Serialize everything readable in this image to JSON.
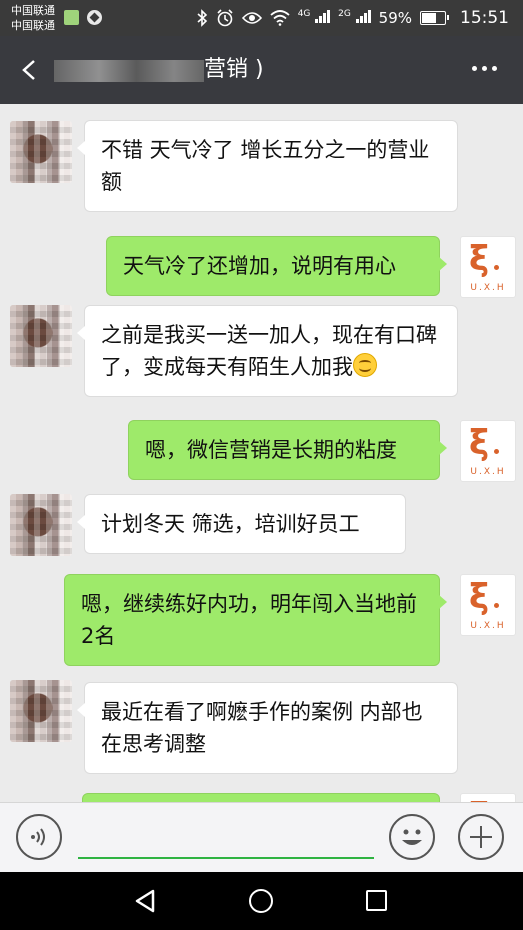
{
  "status_bar": {
    "carrier_1": "中国联通",
    "carrier_2": "中国联通",
    "network_1": "4G",
    "network_2": "2G",
    "battery": "59%",
    "battery_level": 0.59,
    "time": "15:51",
    "icons": [
      "bluetooth-icon",
      "alarm-icon",
      "eye-icon",
      "wifi-icon",
      "signal-icon",
      "battery-icon"
    ]
  },
  "header": {
    "title_suffix": "营销 )"
  },
  "messages": [
    {
      "side": "in",
      "text": "不错 天气冷了 增长五分之一的营业额"
    },
    {
      "side": "out",
      "text": "天气冷了还增加，说明有用心"
    },
    {
      "side": "in",
      "text": "之前是我买一送一加人，现在有口碑了，变成每天有陌生人加我"
    },
    {
      "side": "out",
      "text": "嗯，微信营销是长期的粘度"
    },
    {
      "side": "in",
      "text": "计划冬天 筛选，培训好员工"
    },
    {
      "side": "out",
      "text": "嗯，继续练好内功，明年闯入当地前2名"
    },
    {
      "side": "in",
      "text": "最近在看了啊嬷手作的案例 内部也在思考调整"
    }
  ],
  "logo": {
    "text": "U.X.H",
    "color": "#d9622b"
  },
  "colors": {
    "out_bubble": "#9eea6a",
    "in_bubble": "#ffffff",
    "header_bg": "#393a3f",
    "chat_bg": "#ebebeb"
  }
}
